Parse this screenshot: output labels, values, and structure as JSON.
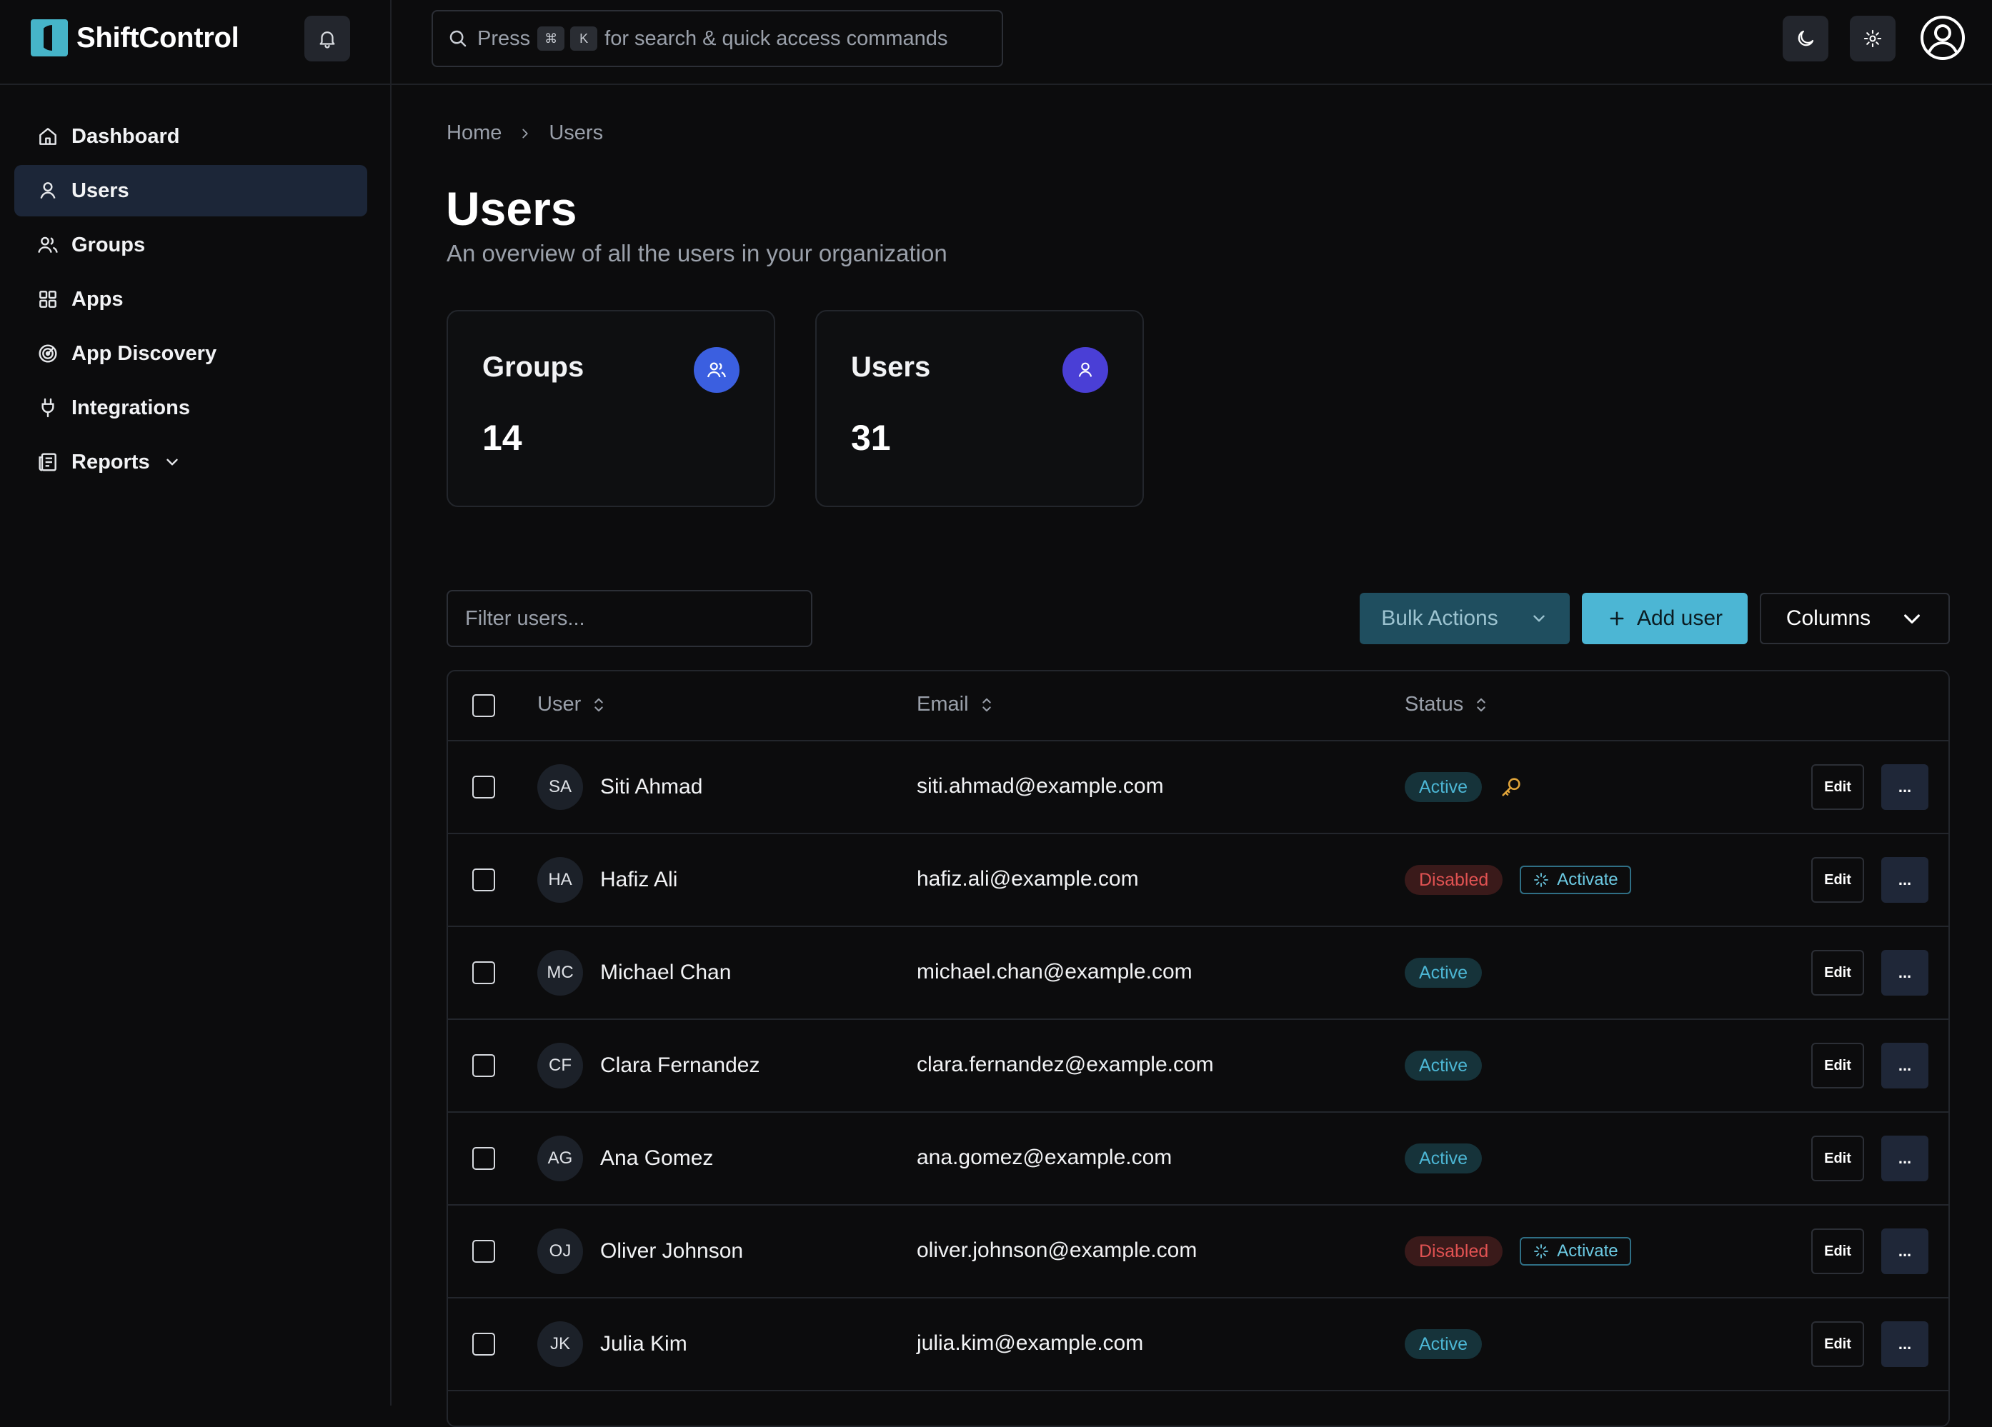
{
  "app": {
    "name": "ShiftControl"
  },
  "search": {
    "prefix": "Press",
    "key1": "⌘",
    "key2": "K",
    "suffix": "for search & quick access commands"
  },
  "sidebar": {
    "items": [
      {
        "label": "Dashboard",
        "icon": "home-icon",
        "active": false
      },
      {
        "label": "Users",
        "icon": "user-icon",
        "active": true
      },
      {
        "label": "Groups",
        "icon": "users-icon",
        "active": false
      },
      {
        "label": "Apps",
        "icon": "grid-icon",
        "active": false
      },
      {
        "label": "App Discovery",
        "icon": "radar-icon",
        "active": false
      },
      {
        "label": "Integrations",
        "icon": "plug-icon",
        "active": false
      },
      {
        "label": "Reports",
        "icon": "report-icon",
        "active": false,
        "expandable": true
      }
    ]
  },
  "breadcrumb": {
    "home": "Home",
    "current": "Users"
  },
  "page": {
    "title": "Users",
    "subtitle": "An overview of all the users in your organization"
  },
  "stats": [
    {
      "label": "Groups",
      "value": "14",
      "color": "#3b5fe0"
    },
    {
      "label": "Users",
      "value": "31",
      "color": "#4a3fd6"
    }
  ],
  "toolbar": {
    "filter_placeholder": "Filter users...",
    "bulk_label": "Bulk Actions",
    "add_label": "Add user",
    "columns_label": "Columns"
  },
  "table": {
    "headers": {
      "user": "User",
      "email": "Email",
      "status": "Status"
    },
    "edit_label": "Edit",
    "more_label": "...",
    "activate_label": "Activate",
    "rows": [
      {
        "initials": "SA",
        "name": "Siti Ahmad",
        "email": "siti.ahmad@example.com",
        "status": "Active",
        "extra": "key"
      },
      {
        "initials": "HA",
        "name": "Hafiz Ali",
        "email": "hafiz.ali@example.com",
        "status": "Disabled",
        "extra": "activate"
      },
      {
        "initials": "MC",
        "name": "Michael Chan",
        "email": "michael.chan@example.com",
        "status": "Active",
        "extra": ""
      },
      {
        "initials": "CF",
        "name": "Clara Fernandez",
        "email": "clara.fernandez@example.com",
        "status": "Active",
        "extra": ""
      },
      {
        "initials": "AG",
        "name": "Ana Gomez",
        "email": "ana.gomez@example.com",
        "status": "Active",
        "extra": ""
      },
      {
        "initials": "OJ",
        "name": "Oliver Johnson",
        "email": "oliver.johnson@example.com",
        "status": "Disabled",
        "extra": "activate"
      },
      {
        "initials": "JK",
        "name": "Julia Kim",
        "email": "julia.kim@example.com",
        "status": "Active",
        "extra": ""
      }
    ]
  },
  "colors": {
    "accent": "#4cb6d4",
    "active_text": "#4cb6d4",
    "disabled_text": "#e05252",
    "background": "#0c0c0d"
  }
}
